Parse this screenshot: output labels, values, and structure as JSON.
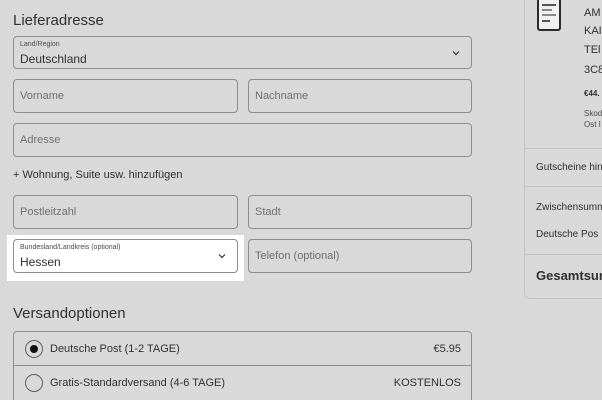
{
  "shipping_address": {
    "title": "Lieferadresse",
    "country": {
      "label": "Land/Region",
      "value": "Deutschland"
    },
    "first_name": {
      "placeholder": "Vorname"
    },
    "last_name": {
      "placeholder": "Nachname"
    },
    "address": {
      "placeholder": "Adresse"
    },
    "add_apartment_link": "+ Wohnung, Suite usw. hinzufügen",
    "postal_code": {
      "placeholder": "Postleitzahl"
    },
    "city": {
      "placeholder": "Stadt"
    },
    "state": {
      "label": "Bundesland/Landkreis (optional)",
      "value": "Hessen"
    },
    "phone": {
      "placeholder": "Telefon (optional)"
    }
  },
  "shipping_options": {
    "title": "Versandoptionen",
    "options": [
      {
        "label": "Deutsche Post (1-2 TAGE)",
        "price": "€5.95",
        "selected": true
      },
      {
        "label": "Gratis-Standardversand (4-6 TAGE)",
        "price": "KOSTENLOS",
        "selected": false
      }
    ]
  },
  "order_summary": {
    "product": {
      "title_lines": [
        "AM",
        "KAI",
        "TEl",
        "3C8"
      ],
      "price": "€44.",
      "variant_lines": [
        "Skod",
        "Ost I"
      ]
    },
    "voucher_label": "Gutscheine hin",
    "subtotal_label": "Zwischensumm",
    "shipping_label": "Deutsche Pos",
    "total_label": "Gesamtsur"
  }
}
